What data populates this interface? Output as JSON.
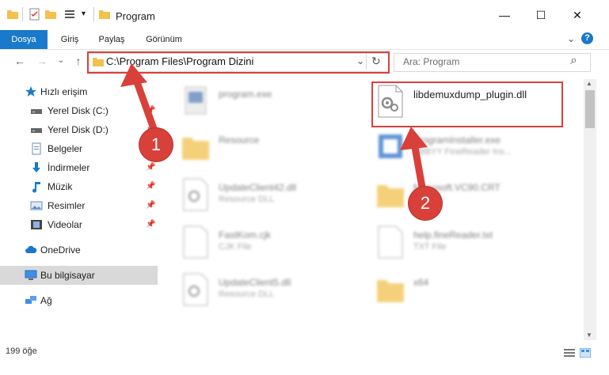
{
  "window": {
    "title": "Program",
    "minimize_glyph": "—",
    "maximize_glyph": "☐",
    "close_glyph": "✕"
  },
  "ribbon": {
    "tabs": [
      {
        "label": "Dosya"
      },
      {
        "label": "Giriş"
      },
      {
        "label": "Paylaş"
      },
      {
        "label": "Görünüm"
      }
    ],
    "help_glyph": "?",
    "expand_glyph": "⌄"
  },
  "address": {
    "path": "C:\\Program Files\\Program Dizini",
    "dropdown_glyph": "⌄",
    "refresh_glyph": "↻"
  },
  "nav": {
    "back_glyph": "←",
    "forward_glyph": "→",
    "recent_glyph": "⌄",
    "up_glyph": "↑"
  },
  "search": {
    "placeholder": "Ara: Program",
    "icon_glyph": "⌕"
  },
  "sidebar": {
    "items": [
      {
        "label": "Hızlı erişim"
      },
      {
        "label": "Yerel Disk (C:)"
      },
      {
        "label": "Yerel Disk (D:)"
      },
      {
        "label": "Belgeler"
      },
      {
        "label": "İndirmeler"
      },
      {
        "label": "Müzik"
      },
      {
        "label": "Resimler"
      },
      {
        "label": "Videolar"
      },
      {
        "label": "OneDrive"
      },
      {
        "label": "Bu bilgisayar"
      },
      {
        "label": "Ağ"
      }
    ]
  },
  "files": [
    {
      "name": "program.exe",
      "type": ""
    },
    {
      "name": "libdemuxdump_plugin.dll",
      "type": ""
    },
    {
      "name": "Resource",
      "type": ""
    },
    {
      "name": "ProgramInstaller.exe",
      "type": "ABBYY FineReader Ins..."
    },
    {
      "name": "UpdateClient42.dll",
      "type": "Resource DLL"
    },
    {
      "name": "Microsoft.VC90.CRT",
      "type": ""
    },
    {
      "name": "FastKom.cjk",
      "type": "CJK File"
    },
    {
      "name": "help.fineReader.txt",
      "type": "TXT File"
    },
    {
      "name": "UpdateClient5.dll",
      "type": "Resource DLL"
    },
    {
      "name": "x64",
      "type": ""
    }
  ],
  "status": {
    "count": "199 öğe"
  },
  "annotations": {
    "step1": "1",
    "step2": "2",
    "color": "#d9403a"
  }
}
